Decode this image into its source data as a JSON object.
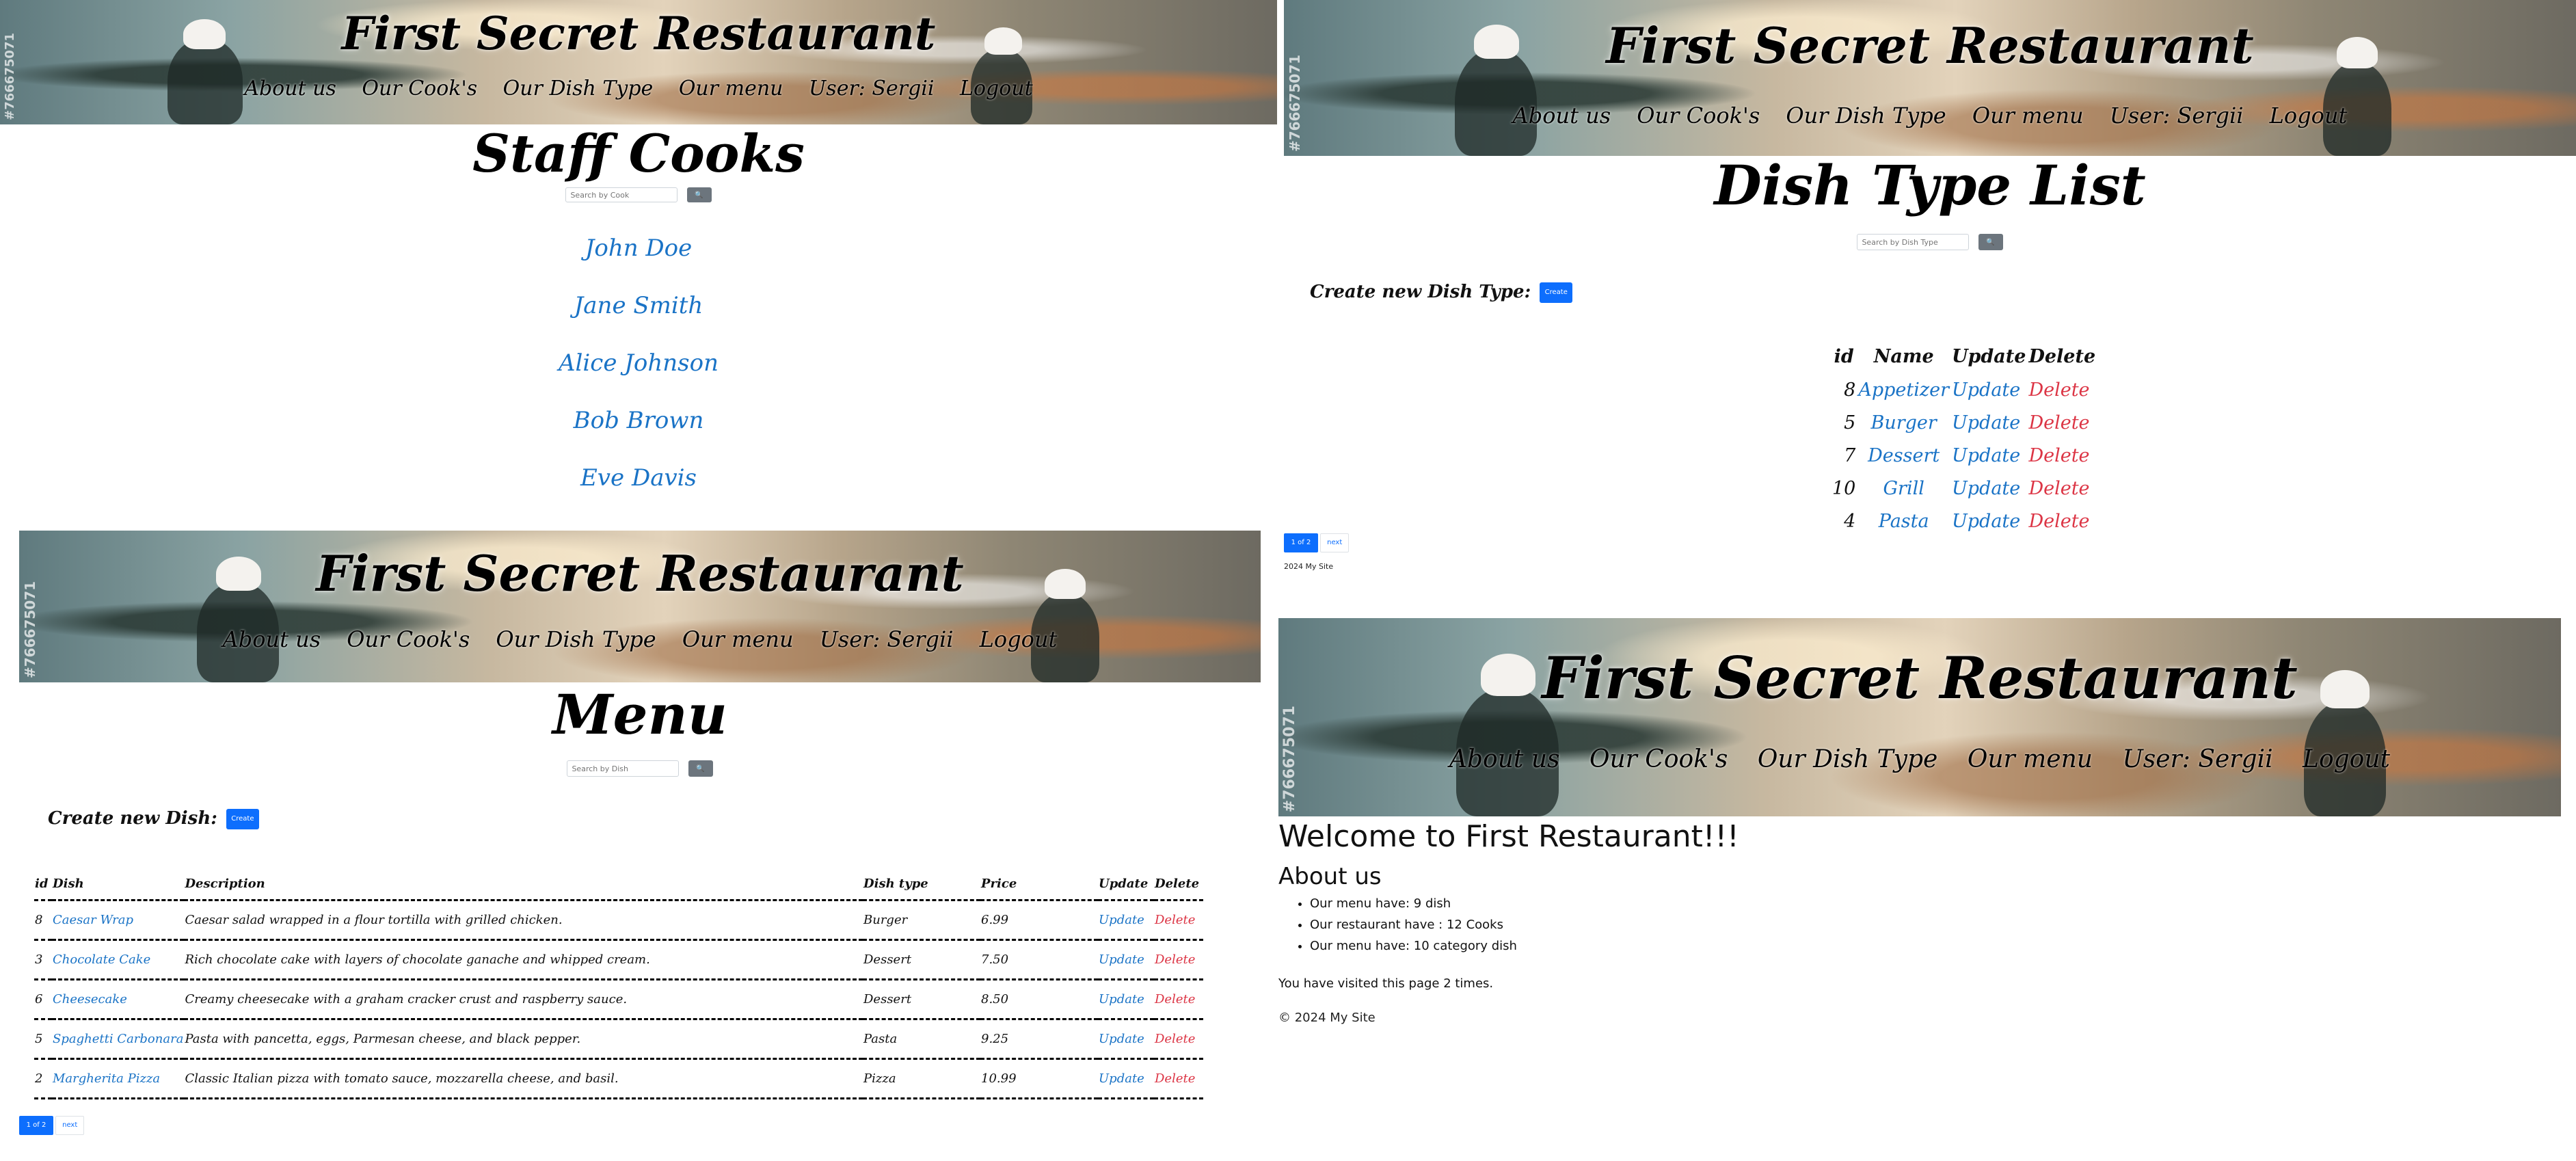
{
  "site": {
    "title": "First Secret Restaurant",
    "watermark": "#766675071",
    "nav": [
      "About us",
      "Our Cook's",
      "Our Dish Type",
      "Our menu",
      "User: Sergii",
      "Logout"
    ]
  },
  "cooks_page": {
    "heading": "Staff Cooks",
    "search_placeholder": "Search by Cook",
    "search_button": "🔍",
    "cooks": [
      "John Doe",
      "Jane Smith",
      "Alice Johnson",
      "Bob Brown",
      "Eve Davis"
    ]
  },
  "dish_type_page": {
    "heading": "Dish Type List",
    "search_placeholder": "Search by Dish Type",
    "search_button": "🔍",
    "create_label": "Create new Dish Type:",
    "create_button": "Create",
    "columns": [
      "id",
      "Name",
      "Update",
      "Delete"
    ],
    "rows": [
      {
        "id": "8",
        "name": "Appetizer",
        "update": "Update",
        "delete": "Delete"
      },
      {
        "id": "5",
        "name": "Burger",
        "update": "Update",
        "delete": "Delete"
      },
      {
        "id": "7",
        "name": "Dessert",
        "update": "Update",
        "delete": "Delete"
      },
      {
        "id": "10",
        "name": "Grill",
        "update": "Update",
        "delete": "Delete"
      },
      {
        "id": "4",
        "name": "Pasta",
        "update": "Update",
        "delete": "Delete"
      }
    ],
    "pager_current": "1 of 2",
    "pager_next": "next",
    "footer": "2024 My Site"
  },
  "menu_page": {
    "heading": "Menu",
    "search_placeholder": "Search by Dish",
    "search_button": "🔍",
    "create_label": "Create new Dish:",
    "create_button": "Create",
    "columns": [
      "id",
      "Dish",
      "Description",
      "Dish type",
      "Price",
      "Update",
      "Delete"
    ],
    "rows": [
      {
        "id": "8",
        "dish": "Caesar Wrap",
        "desc": "Caesar salad wrapped in a flour tortilla with grilled chicken.",
        "type": "Burger",
        "price": "6.99",
        "update": "Update",
        "delete": "Delete"
      },
      {
        "id": "3",
        "dish": "Chocolate Cake",
        "desc": "Rich chocolate cake with layers of chocolate ganache and whipped cream.",
        "type": "Dessert",
        "price": "7.50",
        "update": "Update",
        "delete": "Delete"
      },
      {
        "id": "6",
        "dish": "Cheesecake",
        "desc": "Creamy cheesecake with a graham cracker crust and raspberry sauce.",
        "type": "Dessert",
        "price": "8.50",
        "update": "Update",
        "delete": "Delete"
      },
      {
        "id": "5",
        "dish": "Spaghetti Carbonara",
        "desc": "Pasta with pancetta, eggs, Parmesan cheese, and black pepper.",
        "type": "Pasta",
        "price": "9.25",
        "update": "Update",
        "delete": "Delete"
      },
      {
        "id": "2",
        "dish": "Margherita Pizza",
        "desc": "Classic Italian pizza with tomato sauce, mozzarella cheese, and basil.",
        "type": "Pizza",
        "price": "10.99",
        "update": "Update",
        "delete": "Delete"
      }
    ],
    "pager_current": "1 of 2",
    "pager_next": "next"
  },
  "home_page": {
    "welcome": "Welcome to First Restaurant!!!",
    "about_heading": "About us",
    "stats": [
      "Our menu have: 9 dish",
      "Our restaurant have : 12 Cooks",
      "Our menu have: 10 category dish"
    ],
    "visits": "You have visited this page 2 times.",
    "footer": "© 2024 My Site"
  }
}
